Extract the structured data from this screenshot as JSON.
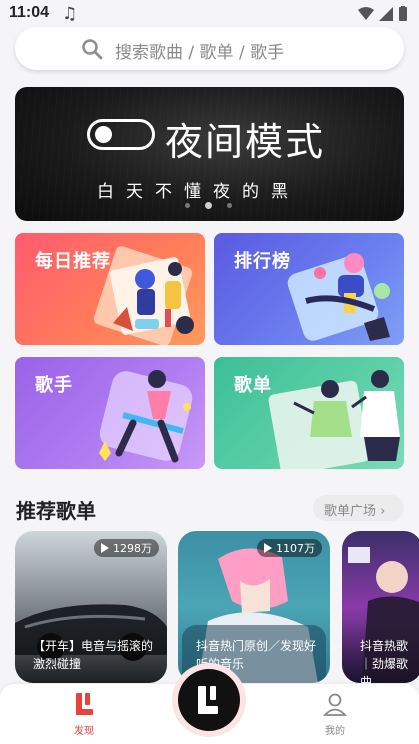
{
  "status_bar": {
    "time": "11:04"
  },
  "search": {
    "placeholder": "搜索歌曲 / 歌单 / 歌手"
  },
  "banner": {
    "title": "夜间模式",
    "subtitle": "白天不懂夜的黑",
    "dots": 3,
    "active_dot": 1
  },
  "categories": [
    {
      "label": "每日推荐",
      "color": "#ff6b63"
    },
    {
      "label": "排行榜",
      "color": "#6577ea"
    },
    {
      "label": "歌手",
      "color": "#a970ee"
    },
    {
      "label": "歌单",
      "color": "#4fc89f"
    }
  ],
  "section": {
    "title": "推荐歌单",
    "more_label": "歌单广场 ›"
  },
  "playlists": [
    {
      "playcount": "1298万",
      "name": "【开车】电音与摇滚的激烈碰撞"
    },
    {
      "playcount": "1107万",
      "name": "抖音热门原创／发现好听的音乐"
    },
    {
      "playcount": "",
      "name": "抖音热歌｜劲爆歌曲"
    }
  ],
  "bottom_nav": {
    "discover_label": "发现",
    "mine_label": "我的",
    "active_color": "#e8433a"
  }
}
